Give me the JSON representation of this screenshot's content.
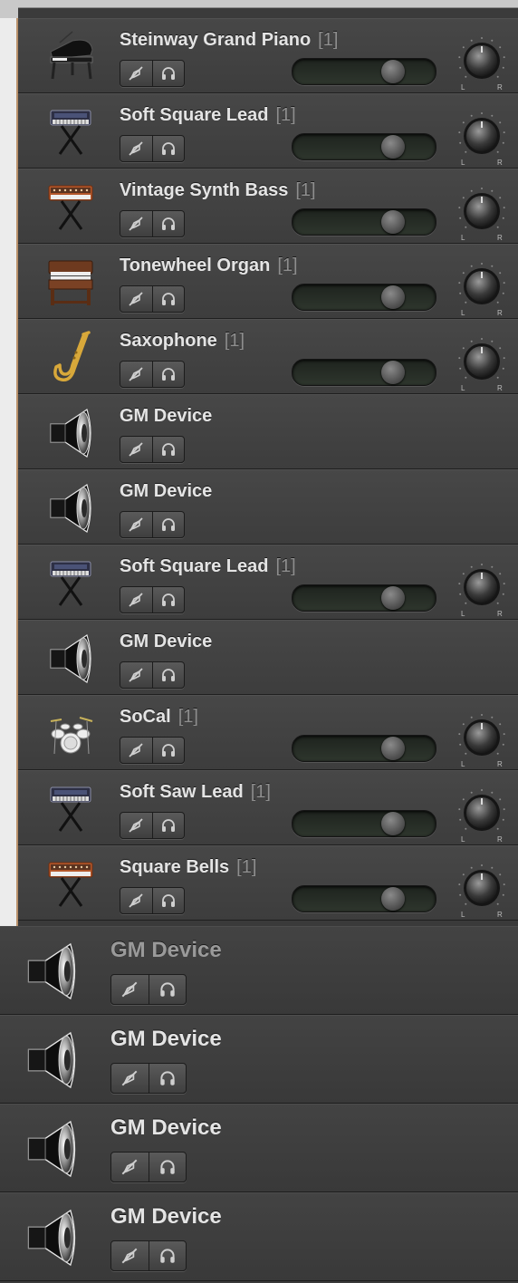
{
  "tracks": [
    {
      "name": "Steinway Grand Piano",
      "count": "[1]",
      "icon": "grand-piano-icon",
      "volume": 0.7,
      "pan": true
    },
    {
      "name": "Soft Square Lead",
      "count": "[1]",
      "icon": "synth-keyboard-icon",
      "volume": 0.7,
      "pan": true
    },
    {
      "name": "Vintage Synth Bass",
      "count": "[1]",
      "icon": "vintage-synth-icon",
      "volume": 0.7,
      "pan": true
    },
    {
      "name": "Tonewheel Organ",
      "count": "[1]",
      "icon": "organ-icon",
      "volume": 0.7,
      "pan": true
    },
    {
      "name": "Saxophone",
      "count": "[1]",
      "icon": "saxophone-icon",
      "volume": 0.7,
      "pan": true
    },
    {
      "name": "GM Device",
      "count": "",
      "icon": "speaker-icon",
      "pan": false
    },
    {
      "name": "GM Device",
      "count": "",
      "icon": "speaker-icon",
      "pan": false
    },
    {
      "name": "Soft Square Lead",
      "count": "[1]",
      "icon": "synth-keyboard-icon",
      "volume": 0.7,
      "pan": true
    },
    {
      "name": "GM Device",
      "count": "",
      "icon": "speaker-icon",
      "pan": false
    },
    {
      "name": "SoCal",
      "count": "[1]",
      "icon": "drum-kit-icon",
      "volume": 0.7,
      "pan": true
    },
    {
      "name": "Soft Saw Lead",
      "count": "[1]",
      "icon": "synth-keyboard-icon",
      "volume": 0.7,
      "pan": true
    },
    {
      "name": "Square Bells",
      "count": "[1]",
      "icon": "vintage-synth-icon",
      "volume": 0.7,
      "pan": true
    }
  ],
  "gm_rows": [
    {
      "name": "GM Device",
      "icon": "speaker-icon",
      "dim": true
    },
    {
      "name": "GM Device",
      "icon": "speaker-icon",
      "dim": false
    },
    {
      "name": "GM Device",
      "icon": "speaker-icon",
      "dim": false
    },
    {
      "name": "GM Device",
      "icon": "speaker-icon",
      "dim": false
    }
  ],
  "pan_labels": {
    "left": "L",
    "right": "R"
  }
}
